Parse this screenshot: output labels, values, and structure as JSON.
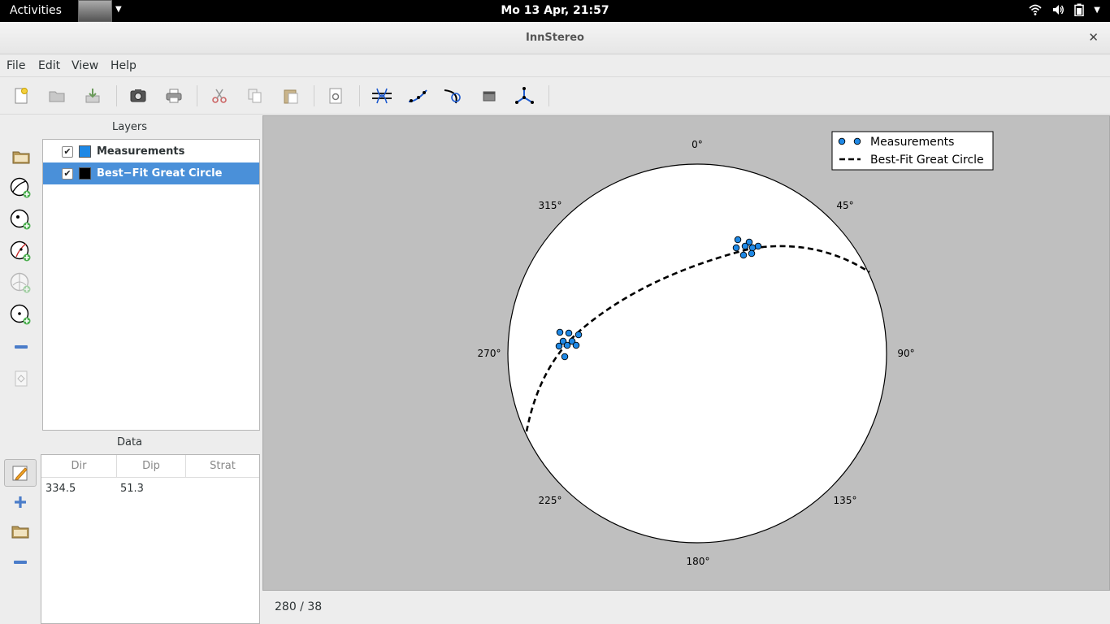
{
  "topbar": {
    "activities": "Activities",
    "clock": "Mo 13 Apr, 21:57"
  },
  "window": {
    "title": "InnStereo"
  },
  "menu": [
    "File",
    "Edit",
    "View",
    "Help"
  ],
  "layers": {
    "title": "Layers",
    "items": [
      {
        "label": "Measurements",
        "color": "#1e88e5",
        "checked": true,
        "selected": false
      },
      {
        "label": "Best−Fit Great Circle",
        "color": "#000000",
        "checked": true,
        "selected": true
      }
    ]
  },
  "data_panel": {
    "title": "Data",
    "columns": [
      "Dir",
      "Dip",
      "Strat"
    ],
    "rows": [
      {
        "dir": "334.5",
        "dip": "51.3",
        "strat": ""
      }
    ]
  },
  "plot": {
    "direction_labels": [
      "0°",
      "45°",
      "90°",
      "135°",
      "180°",
      "225°",
      "270°",
      "315°"
    ],
    "legend": [
      {
        "label": "Measurements",
        "marker": "circle",
        "color": "#1e88e5"
      },
      {
        "label": "Best-Fit Great Circle",
        "marker": "dashed-line",
        "color": "#000000"
      }
    ]
  },
  "status": {
    "cursor_readout": "280 / 38"
  },
  "colors": {
    "selection": "#4a90d9",
    "point": "#1e88e5",
    "plot_background": "#bfbfbf"
  }
}
